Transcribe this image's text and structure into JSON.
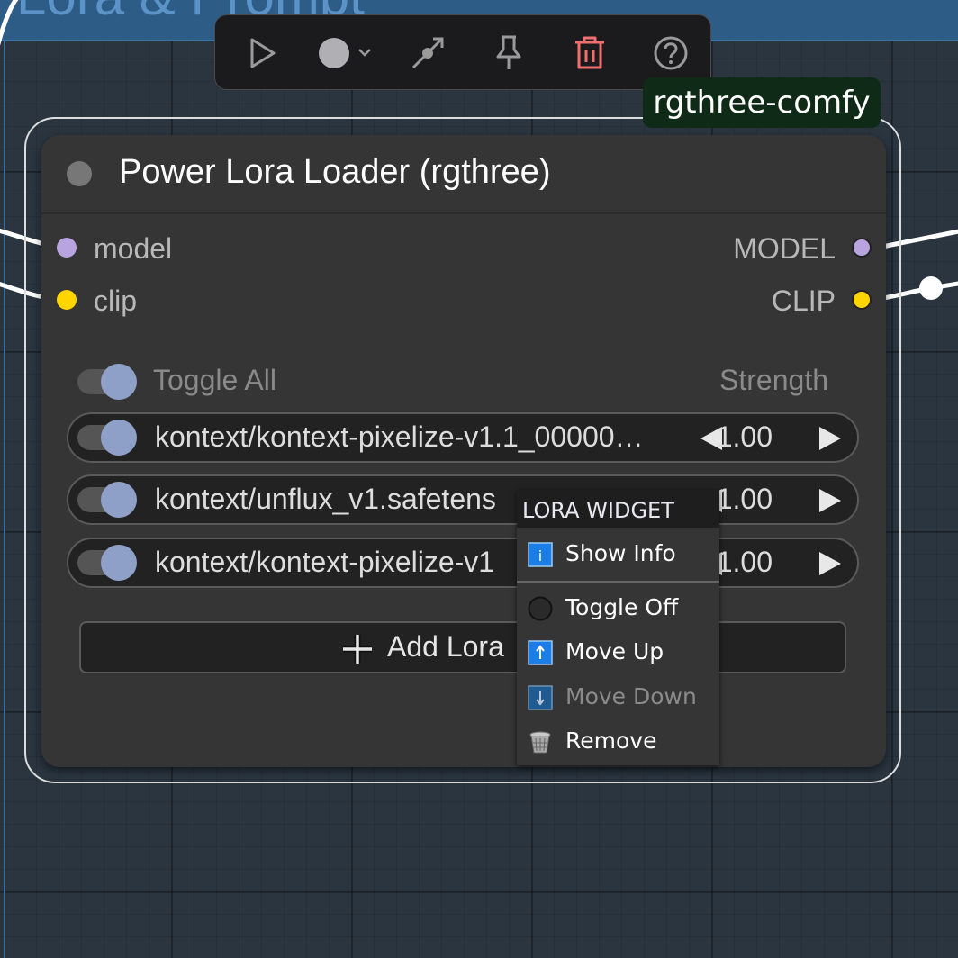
{
  "canvas": {
    "group_title": "Lora & Prompt"
  },
  "toolbar": {
    "items": [
      {
        "name": "run-icon"
      },
      {
        "name": "color-icon"
      },
      {
        "name": "bypass-icon"
      },
      {
        "name": "pin-icon"
      },
      {
        "name": "delete-icon",
        "color": "#f07070"
      },
      {
        "name": "help-icon"
      }
    ]
  },
  "badge": {
    "text": "rgthree-comfy"
  },
  "node": {
    "title": "Power Lora Loader (rgthree)",
    "inputs": [
      {
        "label": "model",
        "color": "#b8a5e0"
      },
      {
        "label": "clip",
        "color": "#ffd500"
      }
    ],
    "outputs": [
      {
        "label": "MODEL",
        "color": "#b8a5e0"
      },
      {
        "label": "CLIP",
        "color": "#ffd500"
      }
    ],
    "header_row": {
      "toggle_label": "Toggle All",
      "strength_label": "Strength"
    },
    "loras": [
      {
        "name": "kontext/kontext-pixelize-v1.1_00000…",
        "strength": "1.00",
        "enabled": true
      },
      {
        "name": "kontext/unflux_v1.safetens",
        "strength": "1.00",
        "enabled": true
      },
      {
        "name": "kontext/kontext-pixelize-v1",
        "strength": "1.00",
        "enabled": true
      }
    ],
    "add_button": "Add Lora"
  },
  "context_menu": {
    "title": "LORA WIDGET",
    "items": [
      {
        "label": "Show Info",
        "icon": "info-icon",
        "enabled": true
      },
      {
        "label": "Toggle Off",
        "icon": "toggle-off-icon",
        "enabled": true
      },
      {
        "label": "Move Up",
        "icon": "arrow-up-icon",
        "enabled": true
      },
      {
        "label": "Move Down",
        "icon": "arrow-down-icon",
        "enabled": false
      },
      {
        "label": "Remove",
        "icon": "trash-icon",
        "enabled": true
      }
    ]
  },
  "colors": {
    "canvas_bg": "#2a3540",
    "group_color": "#2d5d86",
    "node_bg": "#353535",
    "badge_bg": "#0f2a16",
    "menu_icon_blue": "#1a7ee6"
  }
}
